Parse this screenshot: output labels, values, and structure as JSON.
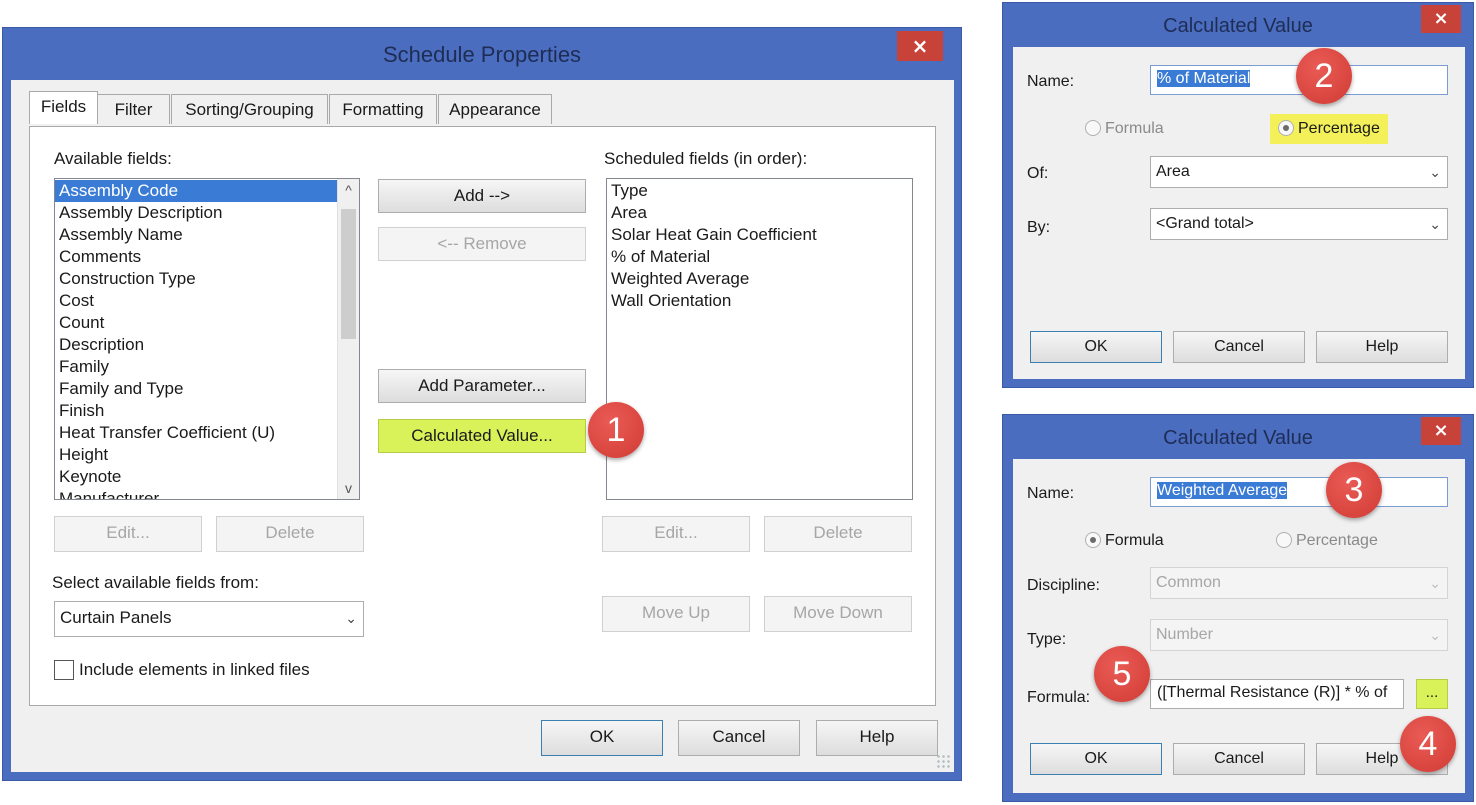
{
  "schedule": {
    "title": "Schedule Properties",
    "close_label": "×",
    "tabs": [
      "Fields",
      "Filter",
      "Sorting/Grouping",
      "Formatting",
      "Appearance"
    ],
    "available_label": "Available fields:",
    "available_fields": [
      "Assembly Code",
      "Assembly Description",
      "Assembly Name",
      "Comments",
      "Construction Type",
      "Cost",
      "Count",
      "Description",
      "Family",
      "Family and Type",
      "Finish",
      "Heat Transfer Coefficient (U)",
      "Height",
      "Keynote",
      "Manufacturer"
    ],
    "scroll_up": "^",
    "scroll_down": "v",
    "scheduled_label": "Scheduled fields (in order):",
    "scheduled_fields": [
      "Type",
      "Area",
      "Solar Heat Gain Coefficient",
      "% of Material",
      "Weighted Average",
      "Wall Orientation"
    ],
    "buttons": {
      "add": "Add -->",
      "remove": "<-- Remove",
      "add_parameter": "Add Parameter...",
      "calculated_value": "Calculated Value...",
      "edit_left": "Edit...",
      "delete_left": "Delete",
      "edit_right": "Edit...",
      "delete_right": "Delete",
      "move_up": "Move Up",
      "move_down": "Move Down",
      "ok": "OK",
      "cancel": "Cancel",
      "help": "Help"
    },
    "select_from_label": "Select available fields from:",
    "select_from_value": "Curtain Panels",
    "include_linked_label": "Include elements in linked files"
  },
  "calc_percentage": {
    "title": "Calculated Value",
    "close_label": "×",
    "name_label": "Name:",
    "name_value": "% of Material",
    "radio_formula": "Formula",
    "radio_percentage": "Percentage",
    "of_label": "Of:",
    "of_value": "Area",
    "by_label": "By:",
    "by_value": "<Grand total>",
    "ok": "OK",
    "cancel": "Cancel",
    "help": "Help"
  },
  "calc_formula": {
    "title": "Calculated Value",
    "close_label": "×",
    "name_label": "Name:",
    "name_value": "Weighted Average",
    "radio_formula": "Formula",
    "radio_percentage": "Percentage",
    "discipline_label": "Discipline:",
    "discipline_value": "Common",
    "type_label": "Type:",
    "type_value": "Number",
    "formula_label": "Formula:",
    "formula_value": "([Thermal Resistance (R)] * % of",
    "ellipsis": "...",
    "ok": "OK",
    "cancel": "Cancel",
    "help": "Help"
  },
  "callouts": [
    "1",
    "2",
    "3",
    "4",
    "5"
  ],
  "dropdown_arrow": "⌄",
  "colors": {
    "window_frame": "#4a6dc0",
    "close_button": "#c7433a",
    "highlight": "#d9f25a",
    "callout": "#d9423b",
    "selection": "#3a7bd5"
  }
}
